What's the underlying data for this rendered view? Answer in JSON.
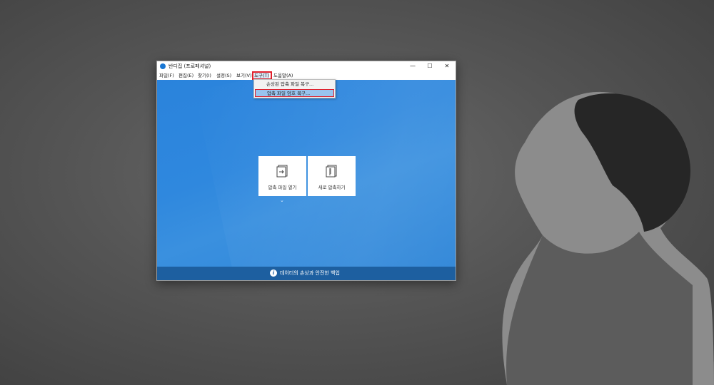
{
  "window": {
    "title": "반디집 (프로페셔널)",
    "controls": {
      "minimize": "—",
      "maximize": "☐",
      "close": "✕"
    }
  },
  "menubar": {
    "items": [
      {
        "label": "파일(F)"
      },
      {
        "label": "편집(E)"
      },
      {
        "label": "찾기(I)"
      },
      {
        "label": "설정(S)"
      },
      {
        "label": "보기(V)"
      },
      {
        "label": "도구(T)"
      },
      {
        "label": "도움말(A)"
      }
    ],
    "active_index": 5
  },
  "dropdown": {
    "items": [
      {
        "label": "손상된 압축 파일 복구..."
      },
      {
        "label": "압축 파일 암호 복구..."
      }
    ],
    "highlighted_index": 1
  },
  "main": {
    "cards": [
      {
        "label": "압축 파일 열기",
        "icon": "open-archive-icon"
      },
      {
        "label": "새로 압축하기",
        "icon": "new-archive-icon"
      }
    ],
    "expand_icon": "chevron-down-icon"
  },
  "footer": {
    "text": "데이터의 손상과 안전한 백업",
    "icon": "info-icon"
  },
  "colors": {
    "accent": "#2a83dc",
    "footer": "#1d5fa0",
    "highlight_outline": "#e01f2b",
    "menu_selection": "#99c4ee"
  }
}
